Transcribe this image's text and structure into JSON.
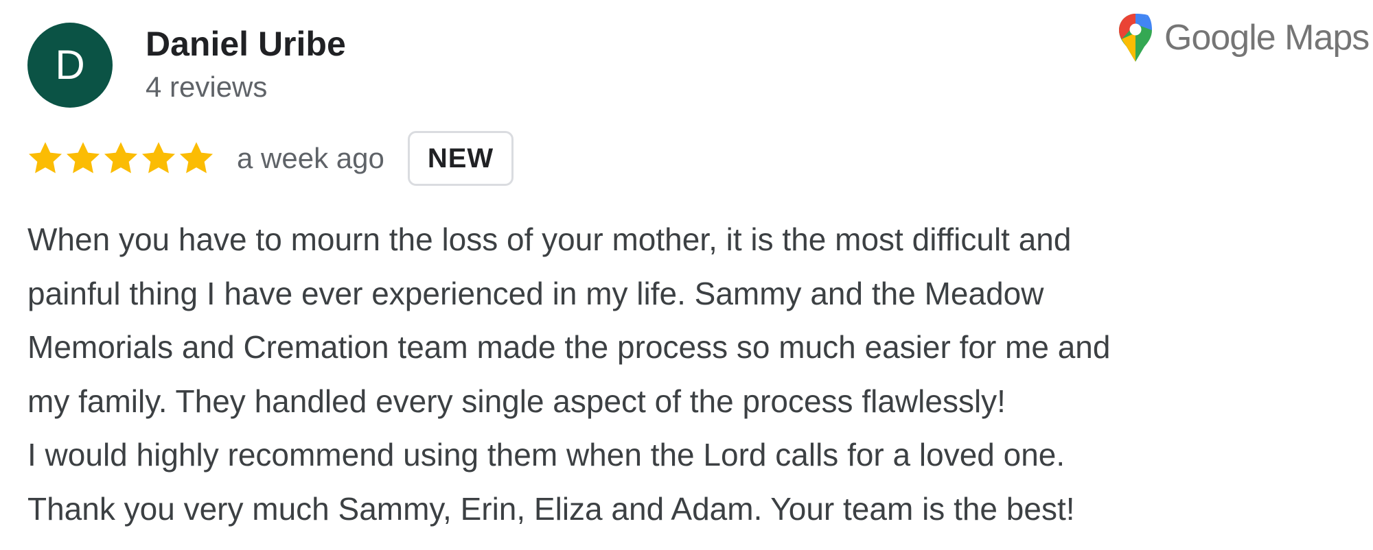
{
  "reviewer": {
    "initial": "D",
    "name": "Daniel Uribe",
    "review_count": "4 reviews",
    "avatar_color": "#0b5345"
  },
  "brand": {
    "logo_text": "Google Maps",
    "icon": "google-maps-pin-icon"
  },
  "rating": {
    "stars": 5,
    "max_stars": 5,
    "star_color": "#fbbc04",
    "date": "a week ago",
    "badge": "NEW"
  },
  "review": {
    "lines": [
      "When you have to mourn the loss of your mother, it is the most difficult and",
      "painful thing I have ever experienced in my life. Sammy and the Meadow",
      "Memorials and Cremation team made the process so much easier for me and",
      "my family. They handled every single aspect of the process flawlessly!",
      "I would highly recommend using them when the Lord calls for a loved one.",
      "Thank you very much Sammy, Erin, Eliza and Adam. Your team is the best!"
    ]
  }
}
